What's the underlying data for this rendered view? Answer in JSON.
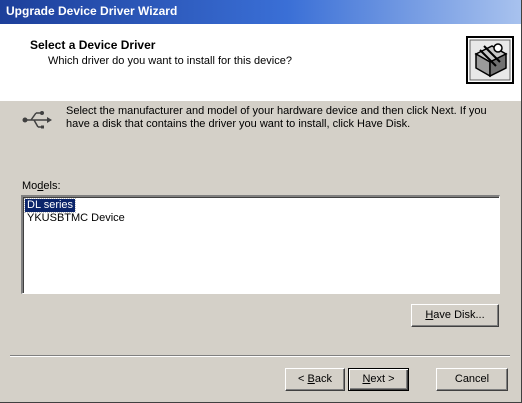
{
  "window": {
    "title": "Upgrade Device Driver Wizard"
  },
  "header": {
    "title": "Select a Device Driver",
    "subtitle": "Which driver do you want to install for this device?"
  },
  "instruction": "Select the manufacturer and model of your hardware device and then click Next. If you have a disk that contains the driver you want to install, click Have Disk.",
  "models": {
    "label_pre": "Mo",
    "label_underline": "d",
    "label_post": "els:",
    "items": [
      "DL series",
      "YKUSBTMC Device"
    ],
    "selected_index": 0
  },
  "buttons": {
    "have_disk": {
      "underline": "H",
      "rest": "ave Disk..."
    },
    "back": {
      "prefix": "< ",
      "underline": "B",
      "rest": "ack"
    },
    "next": {
      "underline": "N",
      "rest": "ext >"
    },
    "cancel": "Cancel"
  },
  "icons": {
    "wizard": "hardware-wizard-icon",
    "usb": "usb-icon"
  },
  "colors": {
    "titlebar_start": "#1d3f9a",
    "selection": "#0a246a",
    "dialog_bg": "#d4d0c8"
  }
}
